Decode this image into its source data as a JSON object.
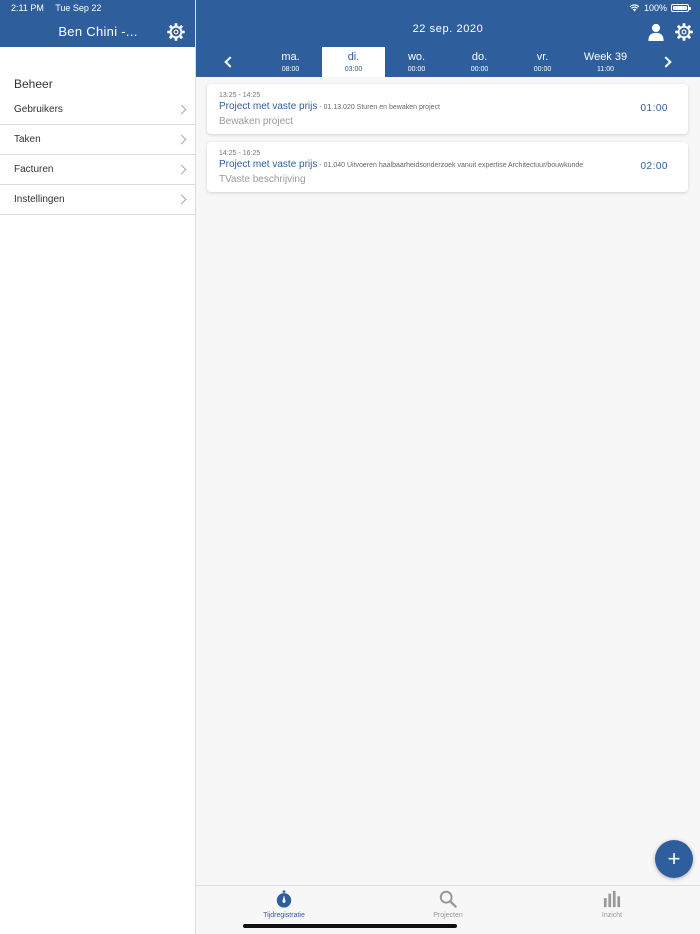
{
  "status_bar": {
    "time": "2:11 PM",
    "date": "Tue Sep 22",
    "battery": "100%"
  },
  "sidebar": {
    "title": "Ben Chini -...",
    "section_title": "Beheer",
    "items": [
      {
        "label": "Gebruikers"
      },
      {
        "label": "Taken"
      },
      {
        "label": "Facturen"
      },
      {
        "label": "Instellingen"
      }
    ]
  },
  "header": {
    "title": "22 sep. 2020"
  },
  "week": {
    "days": [
      {
        "name": "ma.",
        "total": "08:00"
      },
      {
        "name": "di.",
        "total": "03:00"
      },
      {
        "name": "wo.",
        "total": "00:00"
      },
      {
        "name": "do.",
        "total": "00:00"
      },
      {
        "name": "vr.",
        "total": "00:00"
      },
      {
        "name": "Week 39",
        "total": "11:00"
      }
    ],
    "active_day": "di."
  },
  "entries": [
    {
      "time_range": "13:25 - 14:25",
      "project": "Project met vaste prijs",
      "task": " - 01.13.020 Sturen en bewaken project",
      "description": "Bewaken project",
      "duration": "01:00"
    },
    {
      "time_range": "14:25 - 16:25",
      "project": "Project met vaste prijs",
      "task": " - 01.040 Uitvoeren haalbaarheidsonderzoek vanuit expertise Architectuur/bouwkunde",
      "description": "TVaste beschrijving",
      "duration": "02:00"
    }
  ],
  "fab": {
    "label": "+"
  },
  "tabs": [
    {
      "label": "Tijdregistratie",
      "icon": "stopwatch-icon"
    },
    {
      "label": "Projecten",
      "icon": "search-icon"
    },
    {
      "label": "Inzicht",
      "icon": "bar-chart-icon"
    }
  ],
  "colors": {
    "primary": "#2e5f9c",
    "background": "#f7f7f7",
    "muted": "#999999"
  }
}
